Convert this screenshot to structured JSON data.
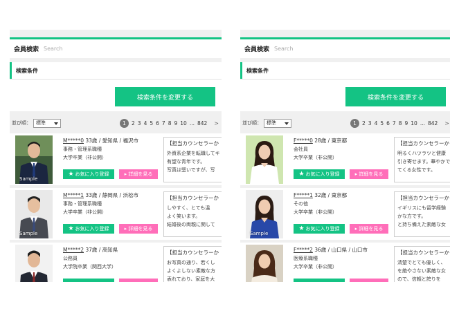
{
  "accent_color": "#14c384",
  "detail_color": "#ff6eb9",
  "panels": [
    {
      "search_title": "会員検索",
      "search_placeholder": "Search",
      "conditions_title": "検索条件",
      "change_button": "検索条件を変更する",
      "sort_label": "並び順：",
      "sort_value": "標準",
      "pages": [
        "1",
        "2",
        "3",
        "4",
        "5",
        "6",
        "7",
        "8",
        "9",
        "10",
        "...",
        "842"
      ],
      "current_page": "1",
      "next_label": ">",
      "cards": [
        {
          "username": "M*****0",
          "age_location": "33歳 / 愛知県 / 福沢市",
          "occupation": "事務・管理系職種",
          "education": "大学卒業（非公開）",
          "photo_label": "Sample",
          "fav_label": "お気に入り登録",
          "detail_label": "詳細を見る",
          "comment_head": "【担当カウンセラーか",
          "comment_body": "外資系企業を転職してキ\n有望な青年です。\n写真は堅いですが、写"
        },
        {
          "username": "M*****1",
          "age_location": "33歳 / 静岡県 / 浜松市",
          "occupation": "事務・管理系職種",
          "education": "大学卒業（非公開）",
          "photo_label": "Sample",
          "fav_label": "お気に入り登録",
          "detail_label": "詳細を見る",
          "comment_head": "【担当カウンセラーか",
          "comment_body": "しやすく、とても温\nよく笑います。\n結婚後の両親に関して"
        },
        {
          "username": "M*****2",
          "age_location": "37歳 / 高知県",
          "occupation": "公務員",
          "education": "大学院卒業（関西大学）",
          "photo_label": "",
          "fav_label": "",
          "detail_label": "",
          "comment_head": "【担当カウンセラーか",
          "comment_body": "お写真の通り、若くし\nよくよしない素敵な方\n表れており、家庭を大"
        }
      ]
    },
    {
      "search_title": "会員検索",
      "search_placeholder": "Search",
      "conditions_title": "検索条件",
      "change_button": "検索条件を変更する",
      "sort_label": "並び順：",
      "sort_value": "標準",
      "pages": [
        "1",
        "2",
        "3",
        "4",
        "5",
        "6",
        "7",
        "8",
        "9",
        "10",
        "...",
        "842"
      ],
      "current_page": "1",
      "next_label": ">",
      "cards": [
        {
          "username": "F*****0",
          "age_location": "28歳 / 東京都",
          "occupation": "会社員",
          "education": "大学卒業（非公開）",
          "photo_label": "",
          "fav_label": "お気に入り登録",
          "detail_label": "詳細を見る",
          "comment_head": "【担当カウンセラーか",
          "comment_body": "明るくハツラツと健康\n引き寄せます。華やかでとてもか\nてくる女性です。"
        },
        {
          "username": "F*****1",
          "age_location": "32歳 / 東京都",
          "occupation": "その他",
          "education": "大学卒業（非公開）",
          "photo_label": "Sample",
          "fav_label": "お気に入り登録",
          "detail_label": "詳細を見る",
          "comment_head": "【担当カウンセラーか",
          "comment_body": "イギリスにも留学経験\nかな方です。\nと持ち備えた素敵な女"
        },
        {
          "username": "F*****2",
          "age_location": "36歳 / 山口県 / 山口市",
          "occupation": "医療系職種",
          "education": "大学卒業（非公開）",
          "photo_label": "",
          "fav_label": "",
          "detail_label": "",
          "comment_head": "【担当カウンセラーか",
          "comment_body": "清楚でとても優しく、\nを絶やさない素敵な女\nので、信頼と誇りを"
        }
      ]
    }
  ]
}
